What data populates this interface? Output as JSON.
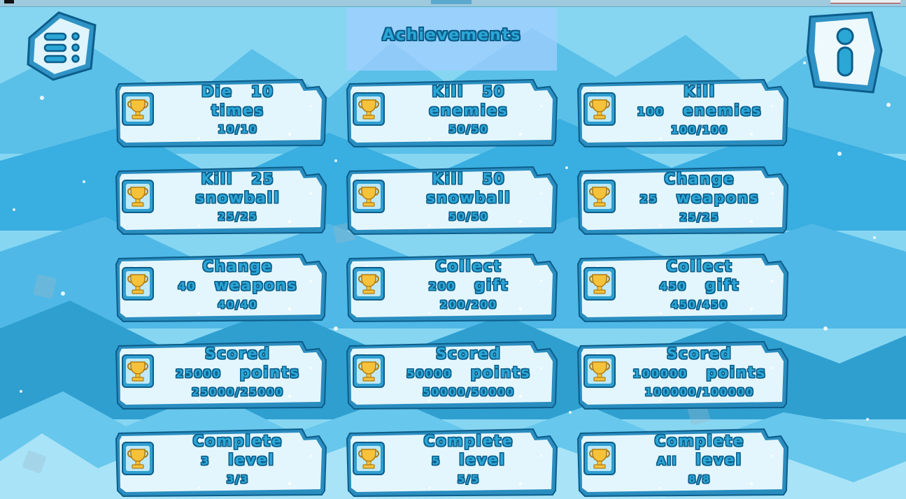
{
  "screen": {
    "title": "Achievements",
    "menu_icon": "menu-list-icon",
    "info_icon": "info-icon"
  },
  "colors": {
    "sky": "#7fd3f0",
    "ice_dark": "#2f9fd0",
    "text_fill": "#2ba7d6",
    "text_outline": "#0c5d8a",
    "card_frame": "#2a8dbf",
    "trophy_gold": "#f6c23a"
  },
  "achievements": [
    {
      "line1": "Die",
      "amount": "10",
      "line2": "times",
      "progress": "10/10",
      "two_line_mode": "amount-first"
    },
    {
      "line1": "Kill",
      "amount": "50",
      "line2": "enemies",
      "progress": "50/50",
      "two_line_mode": "amount-first"
    },
    {
      "line1": "Kill",
      "amount": "100",
      "line2": "enemies",
      "progress": "100/100",
      "two_line_mode": "amount-second"
    },
    {
      "line1": "Kill",
      "amount": "25",
      "line2": "snowball",
      "progress": "25/25",
      "two_line_mode": "amount-first"
    },
    {
      "line1": "Kill",
      "amount": "50",
      "line2": "snowball",
      "progress": "50/50",
      "two_line_mode": "amount-first"
    },
    {
      "line1": "Change",
      "amount": "25",
      "line2": "weapons",
      "progress": "25/25",
      "two_line_mode": "amount-second"
    },
    {
      "line1": "Change",
      "amount": "40",
      "line2": "weapons",
      "progress": "40/40",
      "two_line_mode": "amount-second"
    },
    {
      "line1": "Collect",
      "amount": "200",
      "line2": "gift",
      "progress": "200/200",
      "two_line_mode": "amount-second"
    },
    {
      "line1": "Collect",
      "amount": "450",
      "line2": "gift",
      "progress": "450/450",
      "two_line_mode": "amount-second"
    },
    {
      "line1": "Scored",
      "amount": "25000",
      "line2": "points",
      "progress": "25000/25000",
      "two_line_mode": "amount-second"
    },
    {
      "line1": "Scored",
      "amount": "50000",
      "line2": "points",
      "progress": "50000/50000",
      "two_line_mode": "amount-second"
    },
    {
      "line1": "Scored",
      "amount": "100000",
      "line2": "points",
      "progress": "100000/100000",
      "two_line_mode": "amount-second"
    },
    {
      "line1": "Complete",
      "amount": "3",
      "line2": "level",
      "progress": "3/3",
      "two_line_mode": "amount-second"
    },
    {
      "line1": "Complete",
      "amount": "5",
      "line2": "level",
      "progress": "5/5",
      "two_line_mode": "amount-second"
    },
    {
      "line1": "Complete",
      "amount": "All",
      "line2": "level",
      "progress": "8/8",
      "two_line_mode": "amount-second"
    }
  ],
  "achievement_icon": "trophy-icon"
}
